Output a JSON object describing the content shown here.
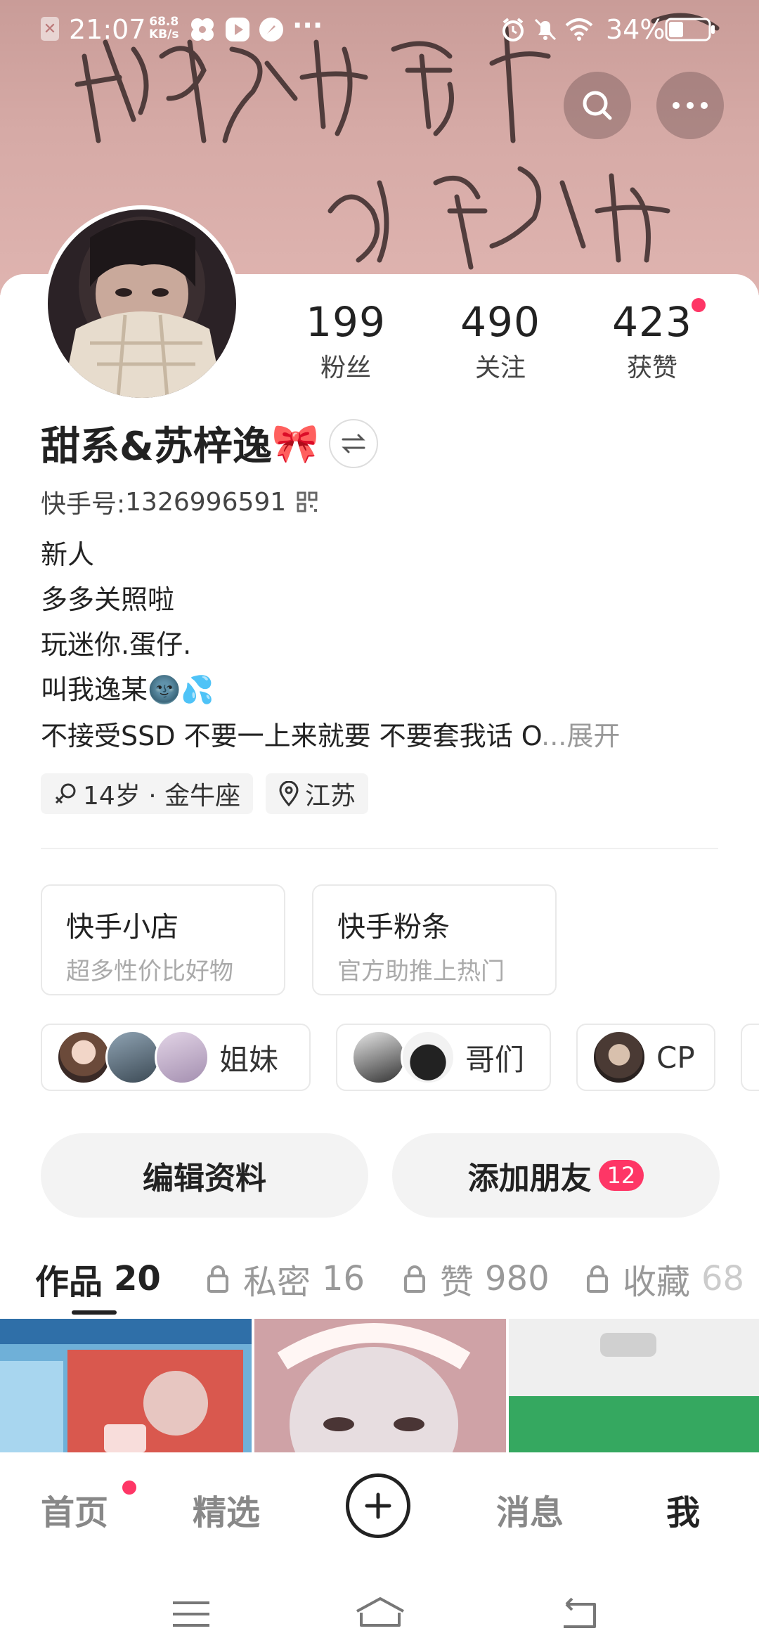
{
  "status_bar": {
    "time": "21:07",
    "net_speed_value": "68.8",
    "net_speed_unit": "KB/s",
    "more": "···",
    "battery": "34%"
  },
  "profile": {
    "name": "甜系&苏梓逸",
    "name_emoji": "🎀",
    "kuaishou_id_label": "快手号: ",
    "kuaishou_id": "1326996591",
    "stats": [
      {
        "value": "199",
        "label": "粉丝"
      },
      {
        "value": "490",
        "label": "关注"
      },
      {
        "value": "423",
        "label": "获赞"
      }
    ],
    "bio": [
      "新人",
      "多多关照啦",
      "玩迷你.蛋仔.",
      "叫我逸某🌚💦",
      "不接受SSD 不要一上来就要 不要套我话 O"
    ],
    "bio_ellipsis": "...",
    "bio_expand": "展开",
    "age_tag": "14岁 · 金牛座",
    "location_tag": "江苏"
  },
  "cards": [
    {
      "title": "快手小店",
      "subtitle": "超多性价比好物"
    },
    {
      "title": "快手粉条",
      "subtitle": "官方助推上热门"
    }
  ],
  "groups": [
    {
      "label": "姐妹"
    },
    {
      "label": "哥们"
    },
    {
      "label": "CP"
    }
  ],
  "actions": {
    "edit_profile": "编辑资料",
    "add_friends": "添加朋友",
    "add_friends_badge": "12"
  },
  "tabs": [
    {
      "label": "作品",
      "count": "20"
    },
    {
      "label": "私密",
      "count": "16"
    },
    {
      "label": "赞",
      "count": "980"
    },
    {
      "label": "收藏",
      "count": "68"
    }
  ],
  "bottom_nav": {
    "home": "首页",
    "featured": "精选",
    "messages": "消息",
    "me": "我"
  },
  "colors": {
    "accent": "#fe3666",
    "cover": "#d6aaa6"
  }
}
